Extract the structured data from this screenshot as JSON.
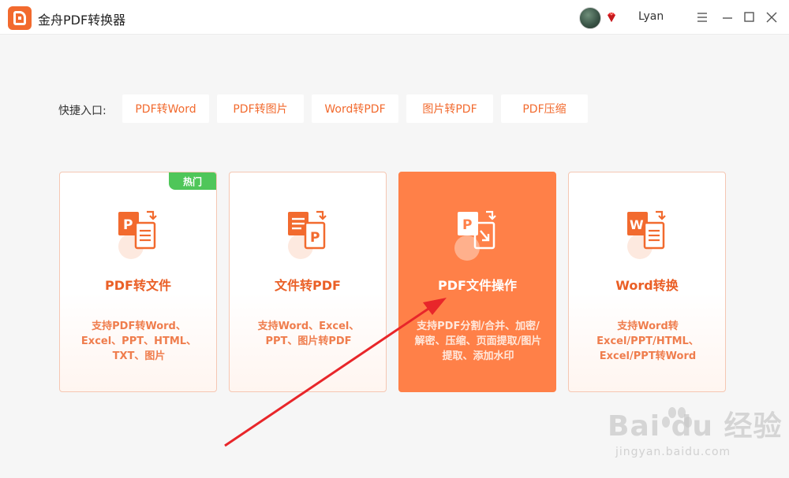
{
  "app": {
    "title": "金舟PDF转换器"
  },
  "user": {
    "name": "Lyan"
  },
  "icons": {
    "app_logo": "app-logo-icon",
    "avatar": "user-avatar",
    "vip": "vip-diamond-icon",
    "menu": "hamburger-menu-icon",
    "minimize": "minimize-icon",
    "maximize": "maximize-icon",
    "close": "close-icon"
  },
  "quick": {
    "label": "快捷入口:",
    "buttons": [
      "PDF转Word",
      "PDF转图片",
      "Word转PDF",
      "图片转PDF",
      "PDF压缩"
    ]
  },
  "cards": [
    {
      "title": "PDF转文件",
      "desc": "支持PDF转Word、Excel、PPT、HTML、TXT、图片",
      "badge": "热门",
      "icon": "pdf-to-file-icon"
    },
    {
      "title": "文件转PDF",
      "desc": "支持Word、Excel、PPT、图片转PDF",
      "icon": "file-to-pdf-icon"
    },
    {
      "title": "PDF文件操作",
      "desc": "支持PDF分割/合并、加密/解密、压缩、页面提取/图片提取、添加水印",
      "icon": "pdf-operations-icon",
      "highlighted": true
    },
    {
      "title": "Word转换",
      "desc": "支持Word转Excel/PPT/HTML、Excel/PPT转Word",
      "icon": "word-convert-icon"
    }
  ],
  "watermark": {
    "text": "Bai du 经验",
    "sub": "jingyan.baidu.com"
  },
  "colors": {
    "accent": "#f26a2e",
    "highlight_card": "#ff8048",
    "hot_badge": "#4fc659",
    "annotation_arrow": "#e8262a"
  }
}
